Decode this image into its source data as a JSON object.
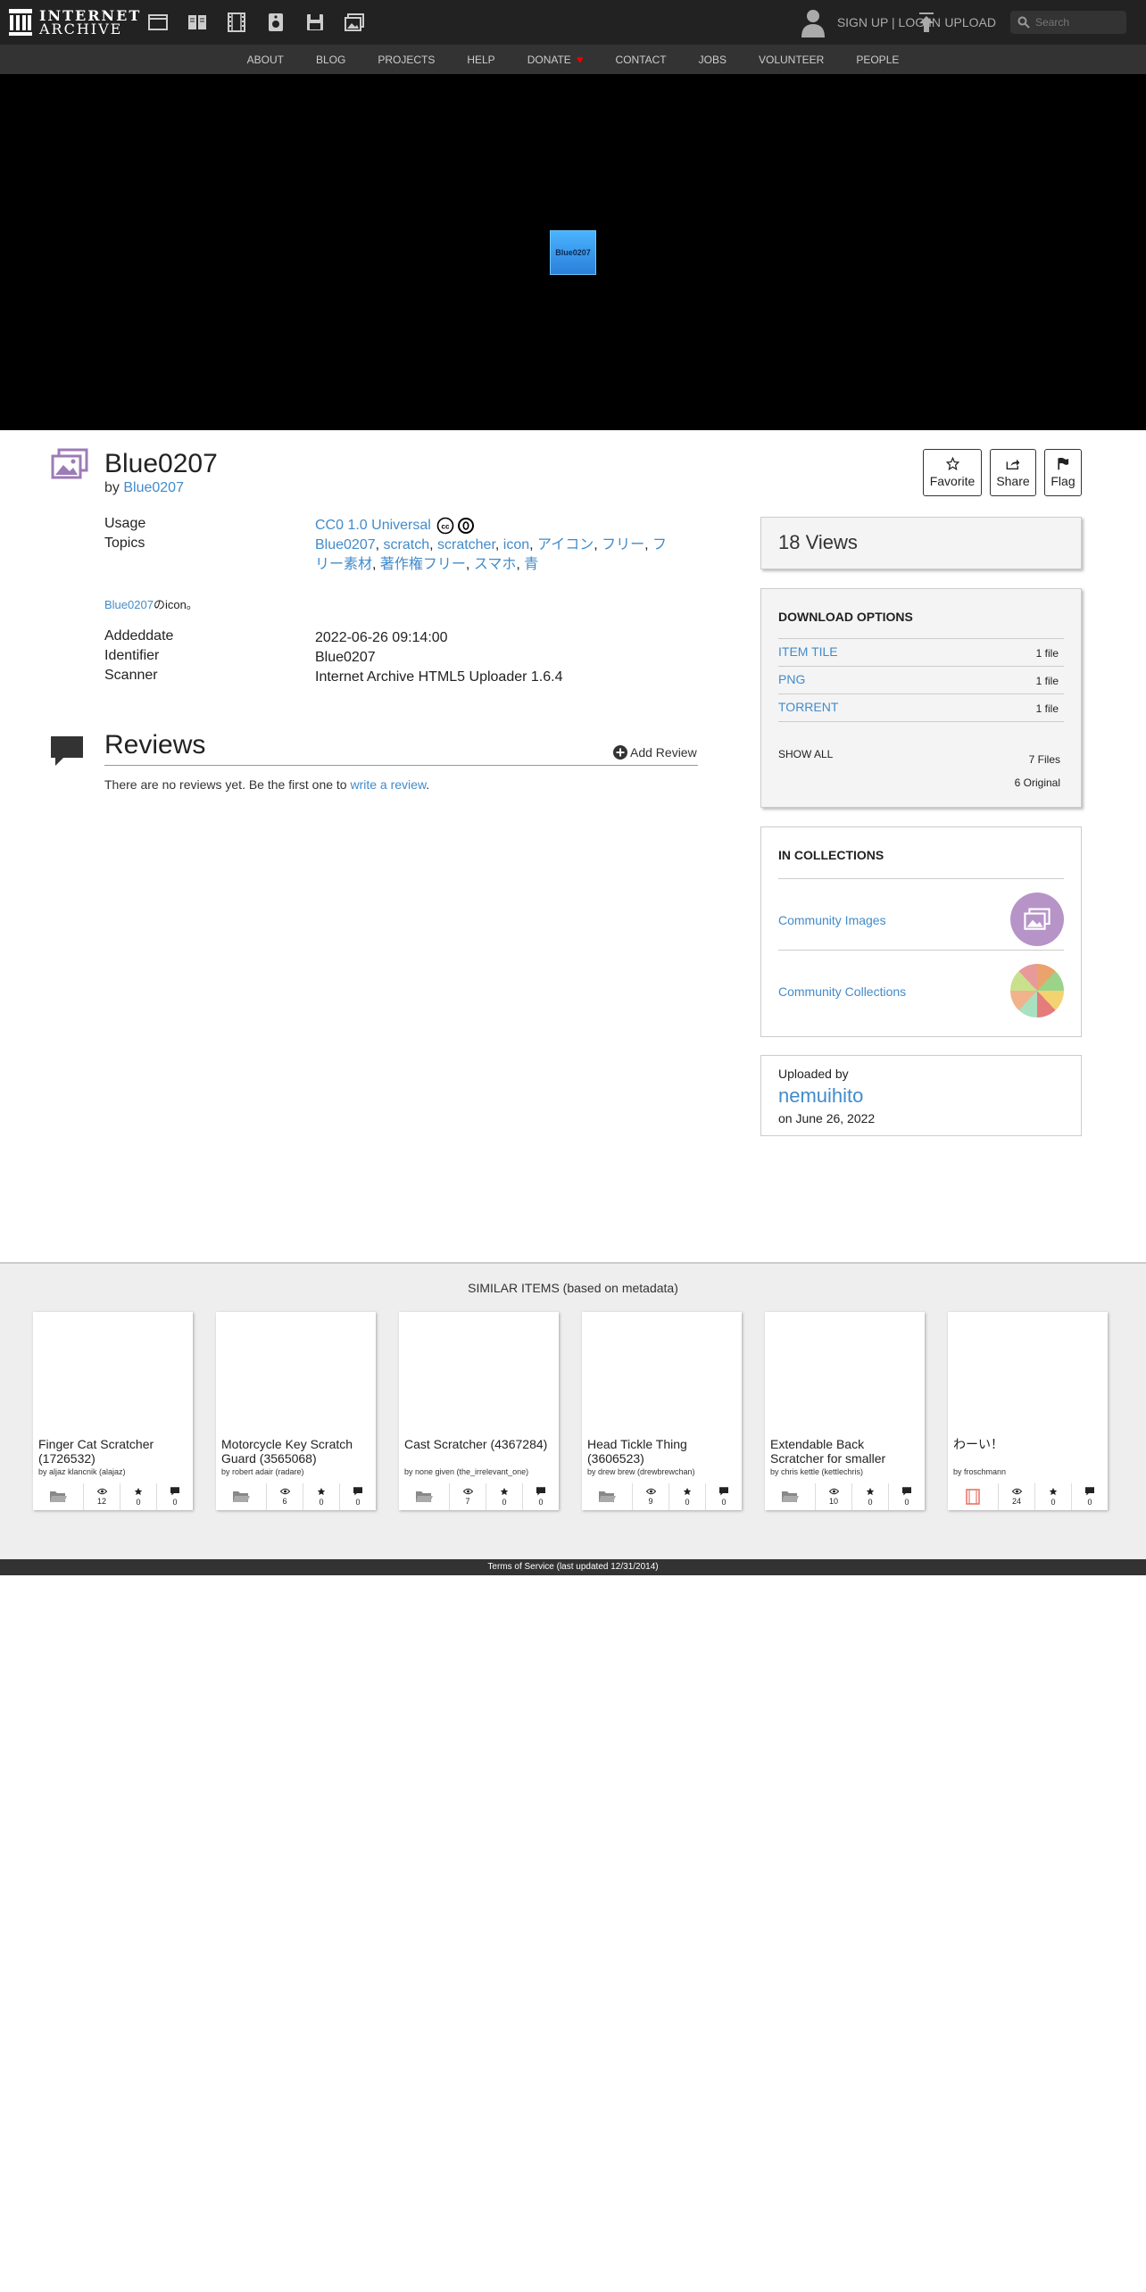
{
  "topnav": {
    "logo_line1": "INTERNET",
    "logo_line2": "ARCHIVE",
    "auth_text": "SIGN UP | LOG IN",
    "upload_label": "UPLOAD",
    "search_placeholder": "Search"
  },
  "subnav": [
    "ABOUT",
    "BLOG",
    "PROJECTS",
    "HELP",
    "DONATE",
    "CONTACT",
    "JOBS",
    "VOLUNTEER",
    "PEOPLE"
  ],
  "theater": {
    "thumb_label": "Blue0207"
  },
  "item": {
    "title": "Blue0207",
    "by_prefix": "by",
    "by_name": "Blue0207",
    "actions": {
      "favorite": "Favorite",
      "share": "Share",
      "flag": "Flag"
    }
  },
  "metadata": {
    "usage_label": "Usage",
    "usage_value": "CC0 1.0 Universal",
    "topics_label": "Topics",
    "topics": [
      "Blue0207",
      "scratch",
      "scratcher",
      "icon",
      "アイコン",
      "フリー",
      "フリー素材",
      "著作権フリー",
      "スマホ",
      "青"
    ],
    "description_link": "Blue0207",
    "description_rest": "のicon。",
    "addeddate_label": "Addeddate",
    "addeddate_value": "2022-06-26 09:14:00",
    "identifier_label": "Identifier",
    "identifier_value": "Blue0207",
    "scanner_label": "Scanner",
    "scanner_value": "Internet Archive HTML5 Uploader 1.6.4"
  },
  "reviews": {
    "title": "Reviews",
    "add_label": "Add Review",
    "empty_text": "There are no reviews yet. Be the first one to ",
    "write_link": "write a review",
    "period": "."
  },
  "sidebar": {
    "views": "18 Views",
    "download_heading": "DOWNLOAD OPTIONS",
    "downloads": [
      {
        "name": "ITEM TILE",
        "count": "1 file"
      },
      {
        "name": "PNG",
        "count": "1 file"
      },
      {
        "name": "TORRENT",
        "count": "1 file"
      }
    ],
    "show_all": "SHOW ALL",
    "files_total": "7 Files",
    "original_total": "6 Original",
    "collections_heading": "IN COLLECTIONS",
    "collections": [
      {
        "name": "Community Images"
      },
      {
        "name": "Community Collections"
      }
    ],
    "uploaded_by_label": "Uploaded by",
    "uploader": "nemuihito",
    "upload_date": "on June 26, 2022"
  },
  "similar": {
    "heading": "SIMILAR ITEMS (based on metadata)",
    "items": [
      {
        "title": "Finger Cat Scratcher (1726532)",
        "by": "by aljaz klancnik (alajaz)",
        "views": "12",
        "favs": "0",
        "reviews": "0",
        "type": "collection"
      },
      {
        "title": "Motorcycle Key Scratch Guard (3565068)",
        "by": "by robert adair (radare)",
        "views": "6",
        "favs": "0",
        "reviews": "0",
        "type": "collection"
      },
      {
        "title": "Cast Scratcher (4367284)",
        "by": "by none given (the_irrelevant_one)",
        "views": "7",
        "favs": "0",
        "reviews": "0",
        "type": "collection"
      },
      {
        "title": "Head Tickle Thing (3606523)",
        "by": "by drew brew (drewbrewchan)",
        "views": "9",
        "favs": "0",
        "reviews": "0",
        "type": "collection"
      },
      {
        "title": "Extendable Back Scratcher for smaller",
        "by": "by chris kettle (kettlechris)",
        "views": "10",
        "favs": "0",
        "reviews": "0",
        "type": "collection"
      },
      {
        "title": "わーい！",
        "by": "by froschmann",
        "views": "24",
        "favs": "0",
        "reviews": "0",
        "type": "movie"
      }
    ]
  },
  "footer": {
    "text": "Terms of Service (last updated 12/31/2014)"
  },
  "colors": {
    "link": "#428bca",
    "topnav": "#222222",
    "subnav": "#333333",
    "heart": "#ee0000",
    "image_type": "#9c7bb6"
  }
}
